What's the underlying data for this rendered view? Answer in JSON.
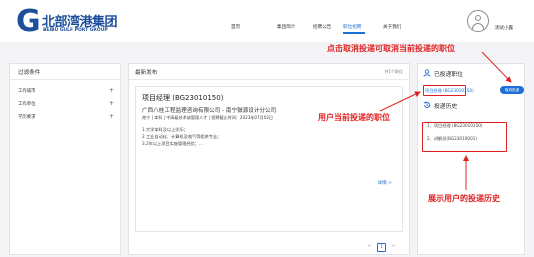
{
  "header": {
    "logo_letter": "G",
    "logo_cn": "北部湾港集团",
    "logo_en": "BEIBU GULF PORT GROUP",
    "nav": [
      {
        "label": "首页"
      },
      {
        "label": "集团简介"
      },
      {
        "label": "招聘公告"
      },
      {
        "label": "职位招聘"
      },
      {
        "label": "关于我们"
      }
    ],
    "active_nav": "职位招聘",
    "username": "测试小露"
  },
  "filters": {
    "title": "过滤条件",
    "items": [
      {
        "label": "工作城市",
        "icon": "plus-icon",
        "symbol": "+"
      },
      {
        "label": "工作单位",
        "icon": "plus-icon",
        "symbol": "+"
      },
      {
        "label": "学历要求",
        "icon": "plus-icon",
        "symbol": "+"
      }
    ]
  },
  "listing": {
    "title": "最新发布",
    "count": "共1个职位",
    "job": {
      "title": "项目经理 (BG23010150)",
      "org": "广西八桂工程监理咨询有限公司 - 南宁鼓源设计分公司",
      "meta": "南宁 | 本科 | 中高级技术或管理人才 | 招聘截止时间：2023年07月02日",
      "requirements": [
        "1.大学本科及以上学历；",
        "2.工业自动化、计算机及电气等相关专业；",
        "3.2年以上项目实施管理经验；..."
      ],
      "detail_label": "详情 >"
    },
    "pager": {
      "prev": "<",
      "current": "1",
      "next": ">"
    }
  },
  "sidebar": {
    "applied_title": "已投递职位",
    "applied_icon": "user-icon",
    "applied_job": "项目经理 (BG23010150)",
    "cancel_label": "取消投递",
    "history_title": "投递历史",
    "history_icon": "history-icon",
    "history": [
      "1、项目经理 (BG23010150)",
      "2、讲解员(BG23010001)"
    ]
  },
  "annotations": {
    "top": "点击取消投递可取消当前投递的职位",
    "middle": "用户当前投递的职位",
    "bottom": "展示用户的投递历史"
  },
  "colors": {
    "accent": "#1d6fd8",
    "brand": "#1d4f9c",
    "annotation": "#e02020"
  }
}
